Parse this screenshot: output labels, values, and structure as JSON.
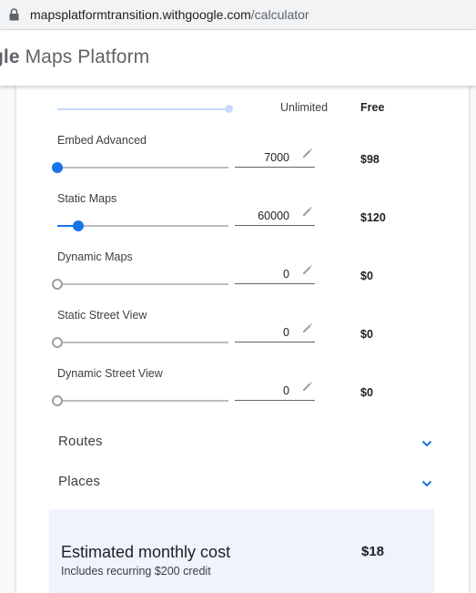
{
  "browser": {
    "url_domain": "mapsplatformtransition.withgoogle.com",
    "url_path": "/calculator"
  },
  "header": {
    "brand_partial": "gle",
    "brand_rest": " Maps Platform"
  },
  "calculator": {
    "top_row": {
      "quantity_label": "Unlimited",
      "price": "Free",
      "slider_fraction": 1.0
    },
    "apis": [
      {
        "label": "Embed Advanced",
        "quantity": "7000",
        "price": "$98",
        "slider_fraction": 0.0
      },
      {
        "label": "Static Maps",
        "quantity": "60000",
        "price": "$120",
        "slider_fraction": 0.12
      },
      {
        "label": "Dynamic Maps",
        "quantity": "0",
        "price": "$0",
        "slider_fraction": 0.0
      },
      {
        "label": "Static Street View",
        "quantity": "0",
        "price": "$0",
        "slider_fraction": 0.0
      },
      {
        "label": "Dynamic Street View",
        "quantity": "0",
        "price": "$0",
        "slider_fraction": 0.0
      }
    ],
    "sections": [
      {
        "title": "Routes",
        "icon": "chevron-down-icon"
      },
      {
        "title": "Places",
        "icon": "chevron-down-icon"
      }
    ],
    "estimate": {
      "title": "Estimated monthly cost",
      "subtitle": "Includes recurring $200 credit",
      "value": "$18"
    }
  },
  "colors": {
    "accent": "#1a73e8",
    "estimate_bg": "#eef3fc"
  }
}
